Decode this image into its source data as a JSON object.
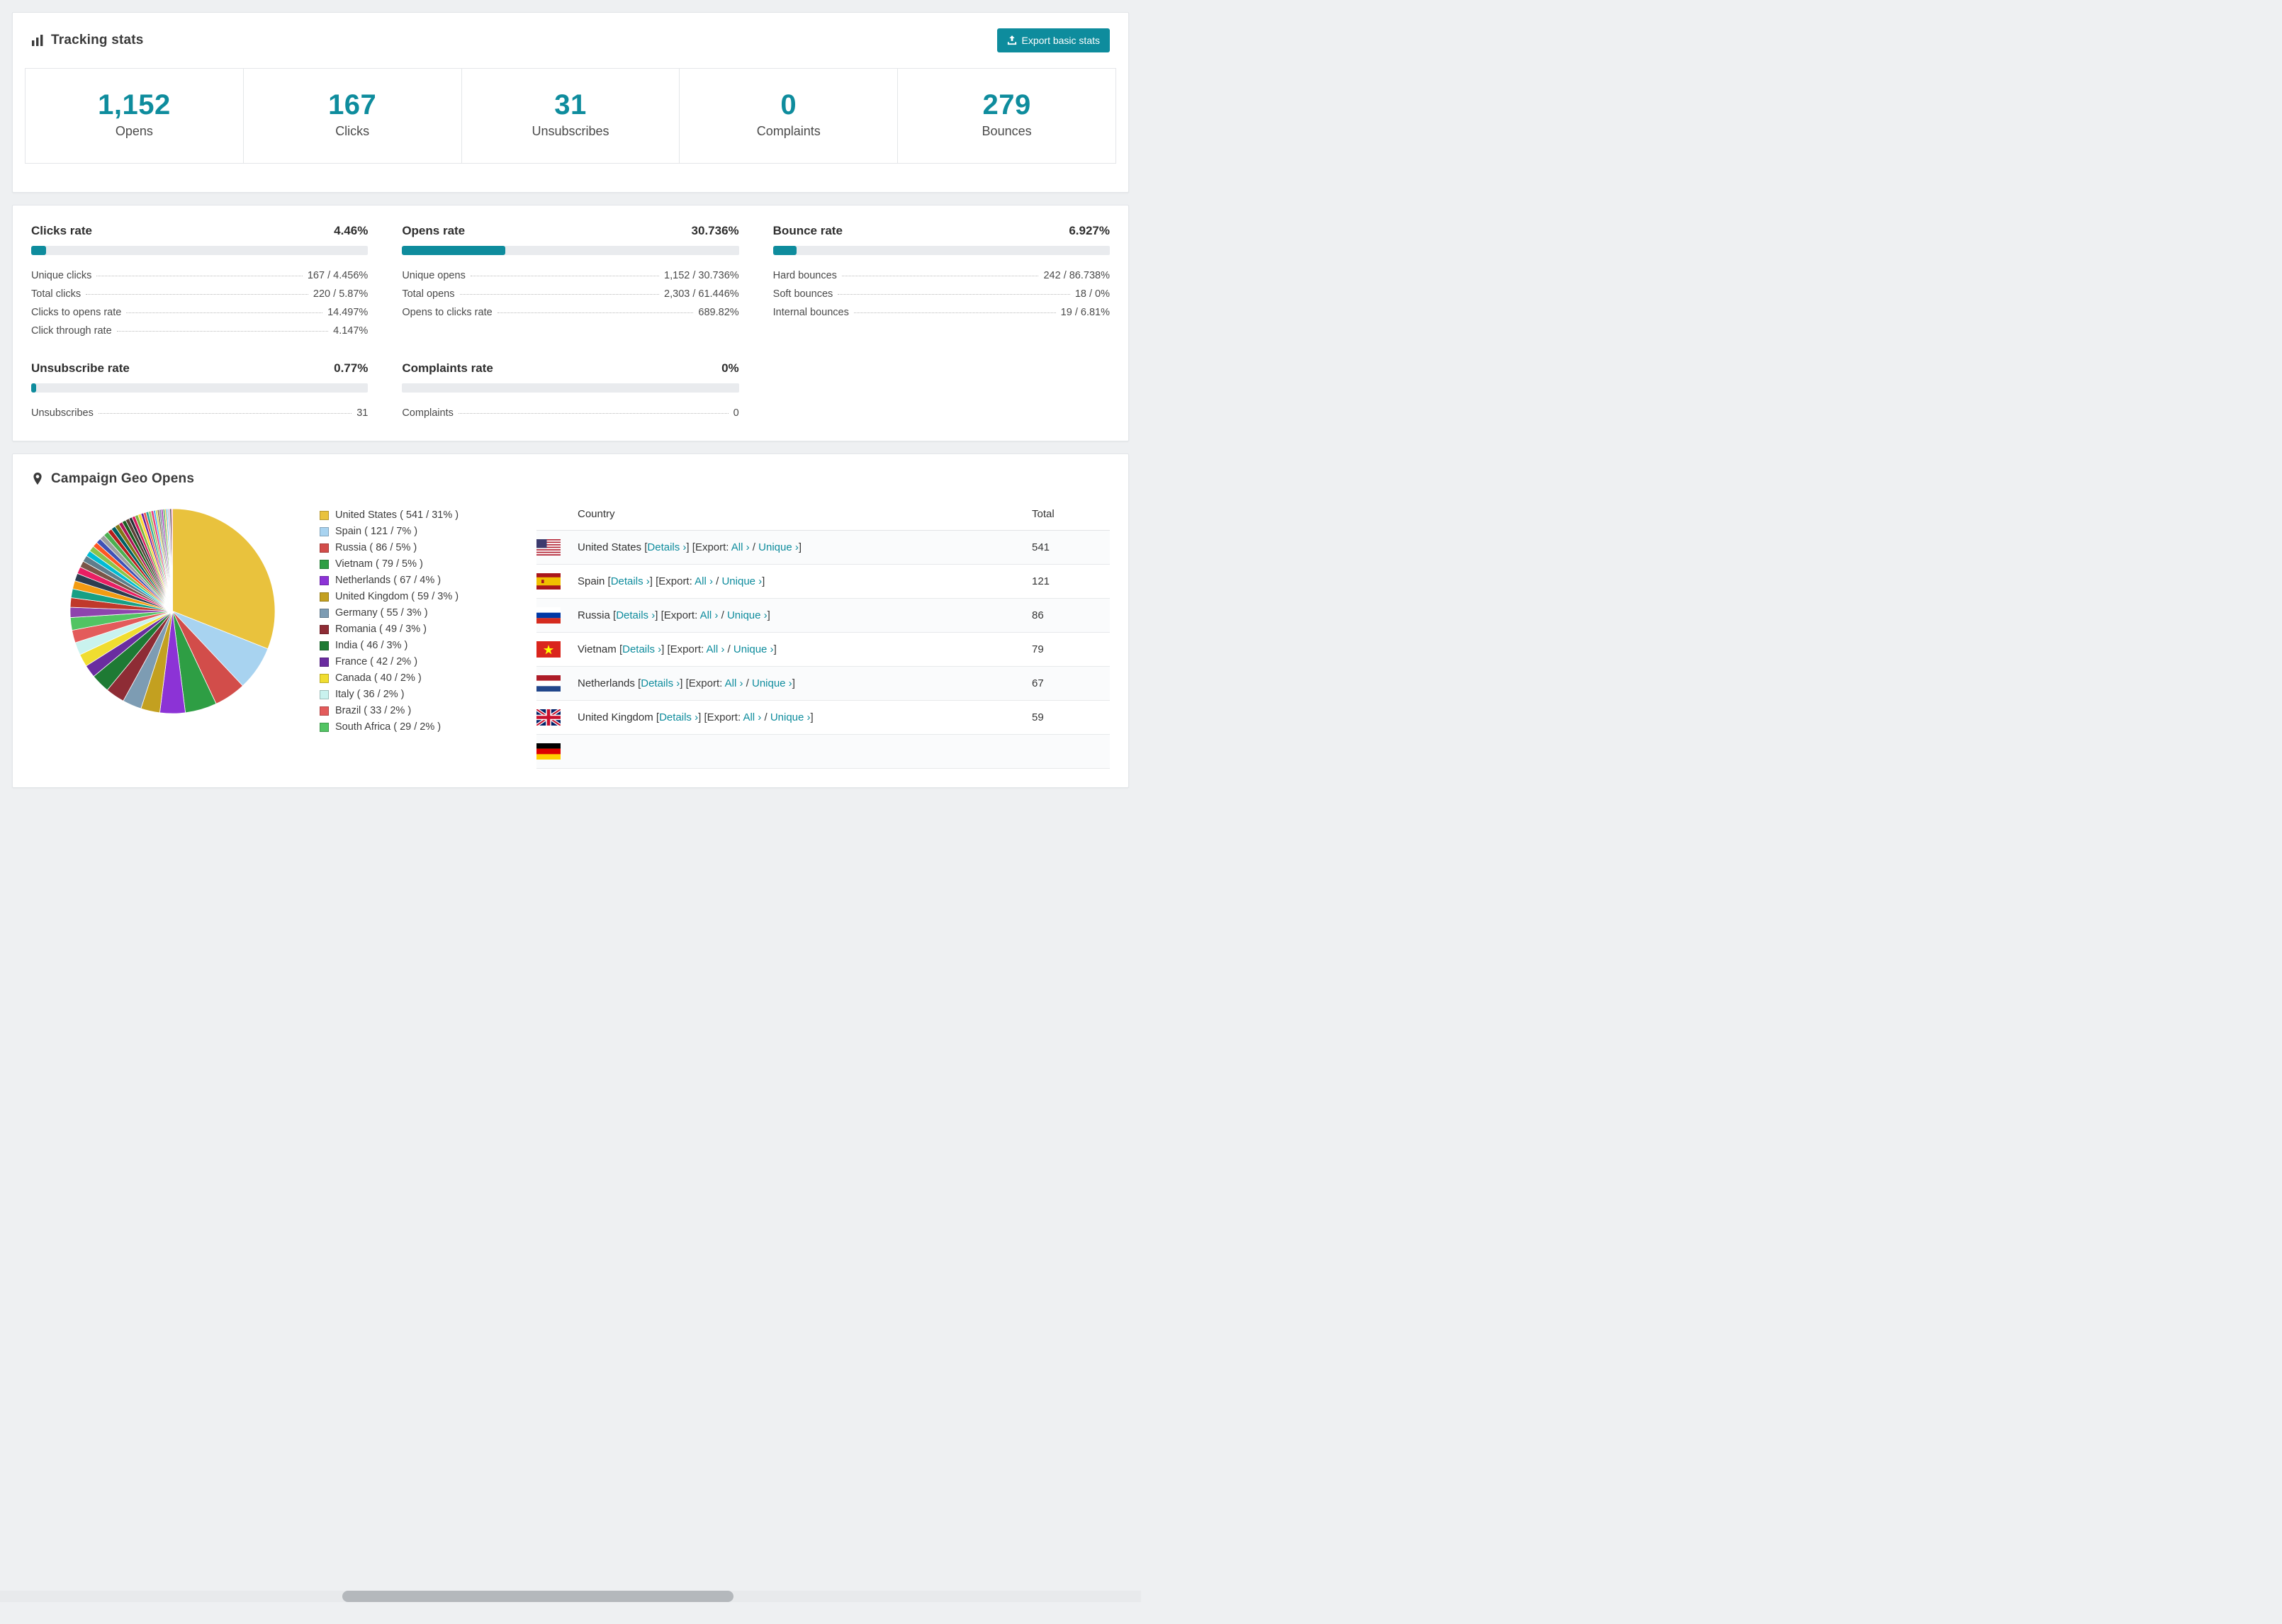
{
  "colors": {
    "accent": "#0e8c9d"
  },
  "tracking": {
    "title": "Tracking stats",
    "export_button": "Export basic stats",
    "stats": [
      {
        "value": "1,152",
        "label": "Opens"
      },
      {
        "value": "167",
        "label": "Clicks"
      },
      {
        "value": "31",
        "label": "Unsubscribes"
      },
      {
        "value": "0",
        "label": "Complaints"
      },
      {
        "value": "279",
        "label": "Bounces"
      }
    ]
  },
  "rates": [
    {
      "title": "Clicks rate",
      "value": "4.46%",
      "pct": 4.46,
      "rows": [
        {
          "label": "Unique clicks",
          "value": "167 / 4.456%"
        },
        {
          "label": "Total clicks",
          "value": "220 / 5.87%"
        },
        {
          "label": "Clicks to opens rate",
          "value": "14.497%"
        },
        {
          "label": "Click through rate",
          "value": "4.147%"
        }
      ]
    },
    {
      "title": "Opens rate",
      "value": "30.736%",
      "pct": 30.736,
      "rows": [
        {
          "label": "Unique opens",
          "value": "1,152 / 30.736%"
        },
        {
          "label": "Total opens",
          "value": "2,303 / 61.446%"
        },
        {
          "label": "Opens to clicks rate",
          "value": "689.82%"
        }
      ]
    },
    {
      "title": "Bounce rate",
      "value": "6.927%",
      "pct": 6.927,
      "rows": [
        {
          "label": "Hard bounces",
          "value": "242 / 86.738%"
        },
        {
          "label": "Soft bounces",
          "value": "18 / 0%"
        },
        {
          "label": "Internal bounces",
          "value": "19 / 6.81%"
        }
      ]
    },
    {
      "title": "Unsubscribe rate",
      "value": "0.77%",
      "pct": 0.77,
      "rows": [
        {
          "label": "Unsubscribes",
          "value": "31"
        }
      ]
    },
    {
      "title": "Complaints rate",
      "value": "0%",
      "pct": 0,
      "rows": [
        {
          "label": "Complaints",
          "value": "0"
        }
      ]
    }
  ],
  "geo": {
    "title": "Campaign Geo Opens",
    "headers": {
      "country": "Country",
      "total": "Total"
    },
    "links": {
      "details": "Details",
      "export": "Export:",
      "all": "All",
      "unique": "Unique",
      "chevron": "›"
    },
    "rows": [
      {
        "flag": "us",
        "country": "United States",
        "total": "541"
      },
      {
        "flag": "es",
        "country": "Spain",
        "total": "121"
      },
      {
        "flag": "ru",
        "country": "Russia",
        "total": "86"
      },
      {
        "flag": "vn",
        "country": "Vietnam",
        "total": "79"
      },
      {
        "flag": "nl",
        "country": "Netherlands",
        "total": "67"
      },
      {
        "flag": "gb",
        "country": "United Kingdom",
        "total": "59"
      },
      {
        "flag": "de",
        "country": "",
        "total": "",
        "partial": true
      }
    ]
  },
  "chart_data": {
    "type": "pie",
    "title": "Campaign Geo Opens",
    "legend_position": "right",
    "slices": [
      {
        "label": "United States",
        "count": 541,
        "pct": 31,
        "color": "#e9c23d"
      },
      {
        "label": "Spain",
        "count": 121,
        "pct": 7,
        "color": "#a8d3f0"
      },
      {
        "label": "Russia",
        "count": 86,
        "pct": 5,
        "color": "#d24d4a"
      },
      {
        "label": "Vietnam",
        "count": 79,
        "pct": 5,
        "color": "#2e9e44"
      },
      {
        "label": "Netherlands",
        "count": 67,
        "pct": 4,
        "color": "#8c33d6"
      },
      {
        "label": "United Kingdom",
        "count": 59,
        "pct": 3,
        "color": "#c3a020"
      },
      {
        "label": "Germany",
        "count": 55,
        "pct": 3,
        "color": "#7d9cb3"
      },
      {
        "label": "Romania",
        "count": 49,
        "pct": 3,
        "color": "#8e2c35"
      },
      {
        "label": "India",
        "count": 46,
        "pct": 3,
        "color": "#1e7a34"
      },
      {
        "label": "France",
        "count": 42,
        "pct": 2,
        "color": "#6a2ca0"
      },
      {
        "label": "Canada",
        "count": 40,
        "pct": 2,
        "color": "#f0dd30"
      },
      {
        "label": "Italy",
        "count": 36,
        "pct": 2,
        "color": "#c9f2ee"
      },
      {
        "label": "Brazil",
        "count": 33,
        "pct": 2,
        "color": "#e35b5b"
      },
      {
        "label": "South Africa",
        "count": 29,
        "pct": 2,
        "color": "#52c463"
      }
    ],
    "other_slices": [
      {
        "pct": 1.6,
        "color": "#8e44ad"
      },
      {
        "pct": 1.5,
        "color": "#c0392b"
      },
      {
        "pct": 1.4,
        "color": "#16a085"
      },
      {
        "pct": 1.3,
        "color": "#f39c12"
      },
      {
        "pct": 1.2,
        "color": "#2c3e50"
      },
      {
        "pct": 1.1,
        "color": "#e91e63"
      },
      {
        "pct": 1.0,
        "color": "#795548"
      },
      {
        "pct": 1.0,
        "color": "#607d8b"
      },
      {
        "pct": 0.9,
        "color": "#00bcd4"
      },
      {
        "pct": 0.9,
        "color": "#8bc34a"
      },
      {
        "pct": 0.8,
        "color": "#ff5722"
      },
      {
        "pct": 0.8,
        "color": "#3f51b5"
      },
      {
        "pct": 0.8,
        "color": "#9e9e9e"
      },
      {
        "pct": 0.8,
        "color": "#4caf50"
      },
      {
        "pct": 0.7,
        "color": "#b71c1c"
      },
      {
        "pct": 0.7,
        "color": "#006064"
      },
      {
        "pct": 0.7,
        "color": "#827717"
      },
      {
        "pct": 0.6,
        "color": "#ad1457"
      },
      {
        "pct": 0.6,
        "color": "#1b5e20"
      },
      {
        "pct": 0.6,
        "color": "#5d4037"
      },
      {
        "pct": 0.5,
        "color": "#263238"
      },
      {
        "pct": 0.5,
        "color": "#d81b60"
      },
      {
        "pct": 0.5,
        "color": "#7cb342"
      },
      {
        "pct": 0.5,
        "color": "#fdd835"
      },
      {
        "pct": 0.4,
        "color": "#6a1b9a"
      },
      {
        "pct": 0.4,
        "color": "#ef5350"
      },
      {
        "pct": 0.4,
        "color": "#26a69a"
      },
      {
        "pct": 0.4,
        "color": "#9ccc65"
      },
      {
        "pct": 0.4,
        "color": "#ec407a"
      },
      {
        "pct": 0.3,
        "color": "#42a5f5"
      },
      {
        "pct": 0.3,
        "color": "#d4e157"
      },
      {
        "pct": 0.3,
        "color": "#8d6e63"
      },
      {
        "pct": 0.3,
        "color": "#78909c"
      },
      {
        "pct": 0.3,
        "color": "#ab47bc"
      },
      {
        "pct": 0.3,
        "color": "#66bb6a"
      },
      {
        "pct": 0.2,
        "color": "#ffa726"
      },
      {
        "pct": 0.2,
        "color": "#29b6f6"
      },
      {
        "pct": 0.2,
        "color": "#bdbdbd"
      },
      {
        "pct": 0.2,
        "color": "#ce93d8"
      },
      {
        "pct": 0.2,
        "color": "#000000"
      },
      {
        "pct": 0.2,
        "color": "#f48fb1"
      }
    ]
  }
}
